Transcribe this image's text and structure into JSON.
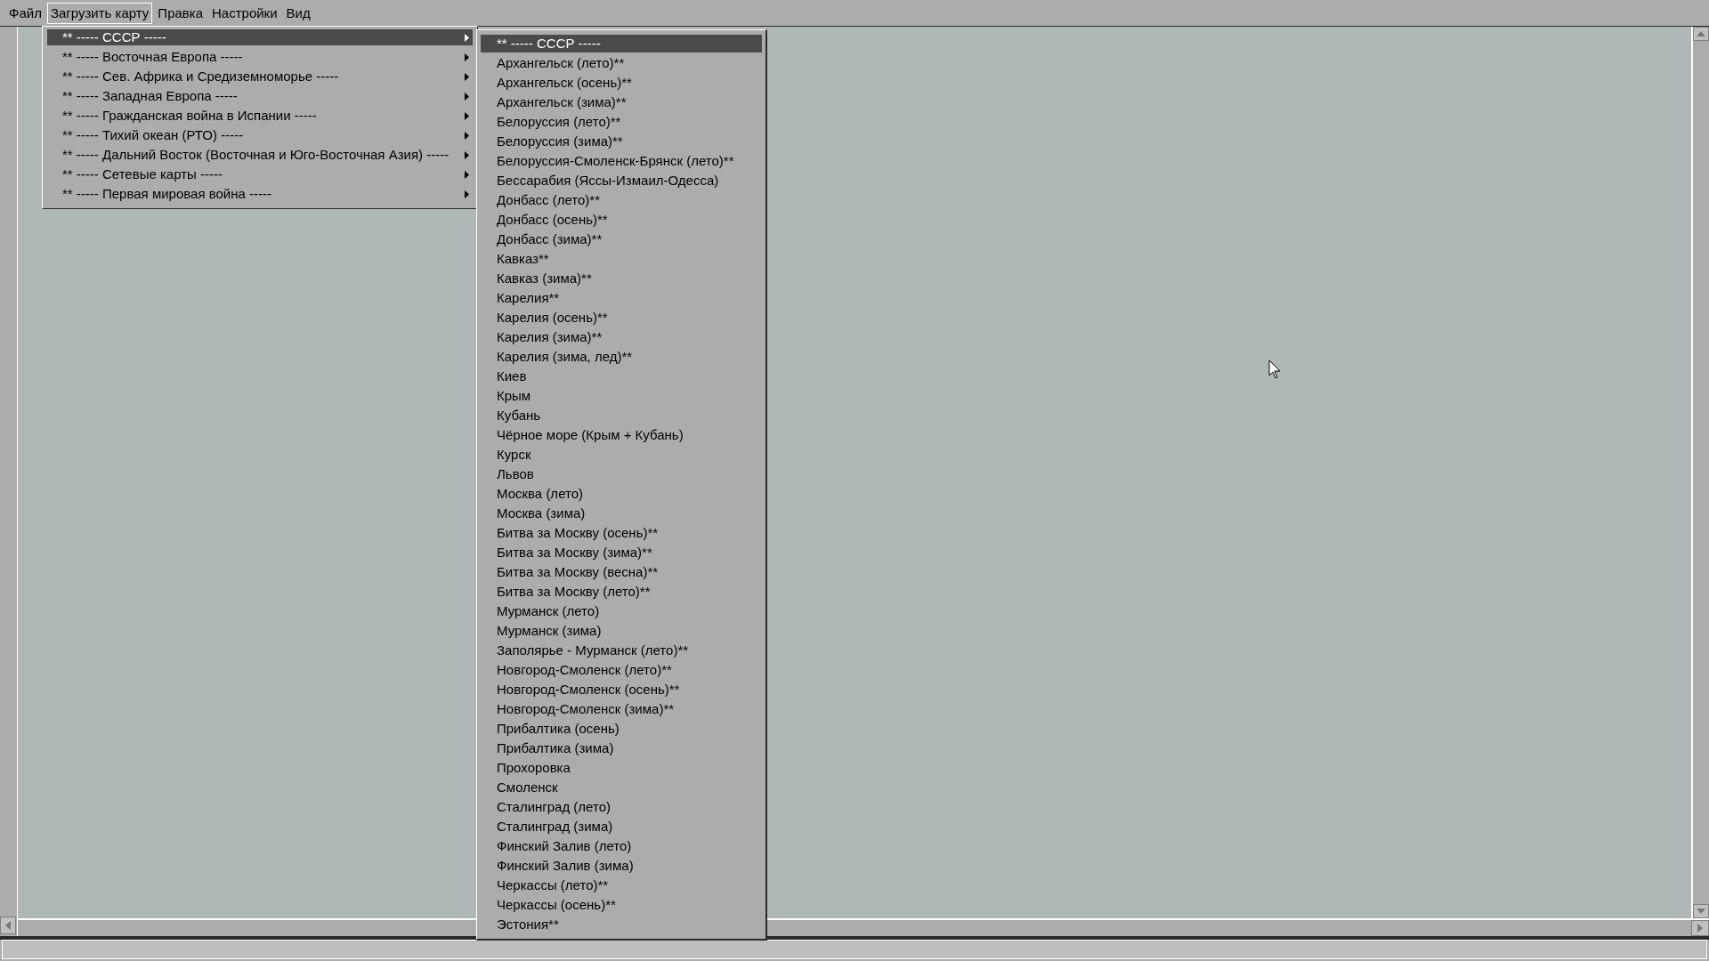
{
  "menu_bar": [
    {
      "label": "Файл",
      "selected": false
    },
    {
      "label": "Загрузить карту",
      "selected": true
    },
    {
      "label": "Правка",
      "selected": false
    },
    {
      "label": "Настройки",
      "selected": false
    },
    {
      "label": "Вид",
      "selected": false
    }
  ],
  "dropdown_menu": {
    "items": [
      {
        "label": "** ----- СССР -----",
        "selected": true,
        "has_submenu": true
      },
      {
        "label": "** ----- Восточная Европа -----",
        "selected": false,
        "has_submenu": true
      },
      {
        "label": "** ----- Сев. Африка и Средиземноморье -----",
        "selected": false,
        "has_submenu": true
      },
      {
        "label": "** ----- Западная Европа -----",
        "selected": false,
        "has_submenu": true
      },
      {
        "label": "** ----- Гражданская война в Испании -----",
        "selected": false,
        "has_submenu": true
      },
      {
        "label": "** ----- Тихий океан (РТО) -----",
        "selected": false,
        "has_submenu": true
      },
      {
        "label": "** ----- Дальний Восток (Восточная и Юго-Восточная Азия) -----",
        "selected": false,
        "has_submenu": true
      },
      {
        "label": "** ----- Сетевые карты -----",
        "selected": false,
        "has_submenu": true
      },
      {
        "label": "** ----- Первая мировая война -----",
        "selected": false,
        "has_submenu": true
      }
    ]
  },
  "submenu": {
    "items": [
      {
        "label": "** ----- СССР -----",
        "selected": true
      },
      {
        "label": "Архангельск (лето)**",
        "selected": false
      },
      {
        "label": "Архангельск (осень)**",
        "selected": false
      },
      {
        "label": "Архангельск (зима)**",
        "selected": false
      },
      {
        "label": "Белоруссия (лето)**",
        "selected": false
      },
      {
        "label": "Белоруссия (зима)**",
        "selected": false
      },
      {
        "label": "Белоруссия-Смоленск-Брянск (лето)**",
        "selected": false
      },
      {
        "label": "Бессарабия (Яссы-Измаил-Одесса)",
        "selected": false
      },
      {
        "label": "Донбасс (лето)**",
        "selected": false
      },
      {
        "label": "Донбасс (осень)**",
        "selected": false
      },
      {
        "label": "Донбасс (зима)**",
        "selected": false
      },
      {
        "label": "Кавказ**",
        "selected": false
      },
      {
        "label": "Кавказ (зима)**",
        "selected": false
      },
      {
        "label": "Карелия**",
        "selected": false
      },
      {
        "label": "Карелия (осень)**",
        "selected": false
      },
      {
        "label": "Карелия (зима)**",
        "selected": false
      },
      {
        "label": "Карелия (зима, лед)**",
        "selected": false
      },
      {
        "label": "Киев",
        "selected": false
      },
      {
        "label": "Крым",
        "selected": false
      },
      {
        "label": "Кубань",
        "selected": false
      },
      {
        "label": "Чёрное море (Крым + Кубань)",
        "selected": false
      },
      {
        "label": "Курск",
        "selected": false
      },
      {
        "label": "Львов",
        "selected": false
      },
      {
        "label": "Москва (лето)",
        "selected": false
      },
      {
        "label": "Москва (зима)",
        "selected": false
      },
      {
        "label": "Битва за Москву (осень)**",
        "selected": false
      },
      {
        "label": "Битва за Москву (зима)**",
        "selected": false
      },
      {
        "label": "Битва за Москву (весна)**",
        "selected": false
      },
      {
        "label": "Битва за Москву (лето)**",
        "selected": false
      },
      {
        "label": "Мурманск (лето)",
        "selected": false
      },
      {
        "label": "Мурманск (зима)",
        "selected": false
      },
      {
        "label": "Заполярье - Мурманск (лето)**",
        "selected": false
      },
      {
        "label": "Новгород-Смоленск (лето)**",
        "selected": false
      },
      {
        "label": "Новгород-Смоленск (осень)**",
        "selected": false
      },
      {
        "label": "Новгород-Смоленск (зима)**",
        "selected": false
      },
      {
        "label": "Прибалтика (осень)",
        "selected": false
      },
      {
        "label": "Прибалтика (зима)",
        "selected": false
      },
      {
        "label": "Прохоровка",
        "selected": false
      },
      {
        "label": "Смоленск",
        "selected": false
      },
      {
        "label": "Сталинград (лето)",
        "selected": false
      },
      {
        "label": "Сталинград (зима)",
        "selected": false
      },
      {
        "label": "Финский Залив (лето)",
        "selected": false
      },
      {
        "label": "Финский Залив (зима)",
        "selected": false
      },
      {
        "label": "Черкассы (лето)**",
        "selected": false
      },
      {
        "label": "Черкассы (осень)**",
        "selected": false
      },
      {
        "label": "Эстония**",
        "selected": false
      }
    ]
  }
}
